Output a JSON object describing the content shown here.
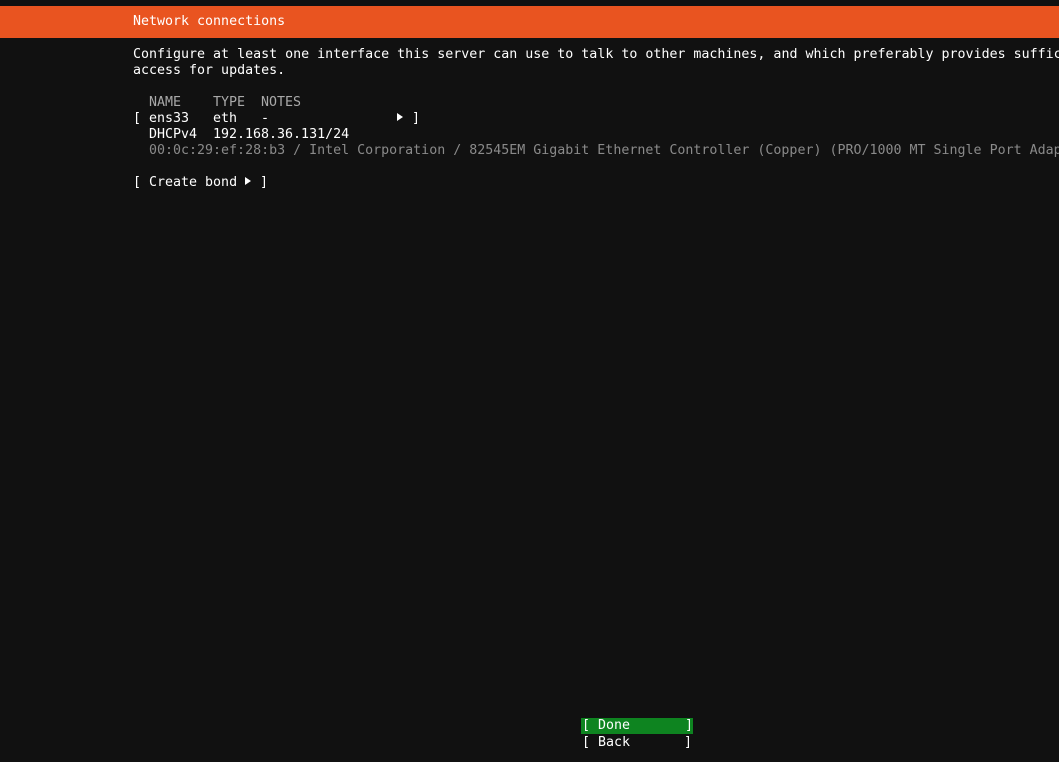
{
  "header": {
    "title": "Network connections",
    "accent_color": "#e95420"
  },
  "description": {
    "line1": "Configure at least one interface this server can use to talk to other machines, and which preferably provides suffic",
    "line2": "access for updates."
  },
  "table": {
    "headers": {
      "name": "NAME",
      "type": "TYPE",
      "notes": "NOTES"
    },
    "interfaces": [
      {
        "open_bracket": "[",
        "name": "ens33",
        "type": "eth",
        "notes": "-",
        "arrow_icon": "triangle-right-icon",
        "close_bracket": "]",
        "address_mode": "DHCPv4",
        "address": "192.168.36.131/24",
        "hardware": "00:0c:29:ef:28:b3 / Intel Corporation / 82545EM Gigabit Ethernet Controller (Copper) (PRO/1000 MT Single Port Adap"
      }
    ]
  },
  "create_bond": {
    "label_left": "[ Create bond",
    "label_right": "]",
    "arrow_icon": "triangle-right-icon"
  },
  "footer": {
    "done_left": "[ Done",
    "done_right": "]",
    "back_left": "[ Back",
    "back_right": "]",
    "done_color": "#0e8420"
  }
}
